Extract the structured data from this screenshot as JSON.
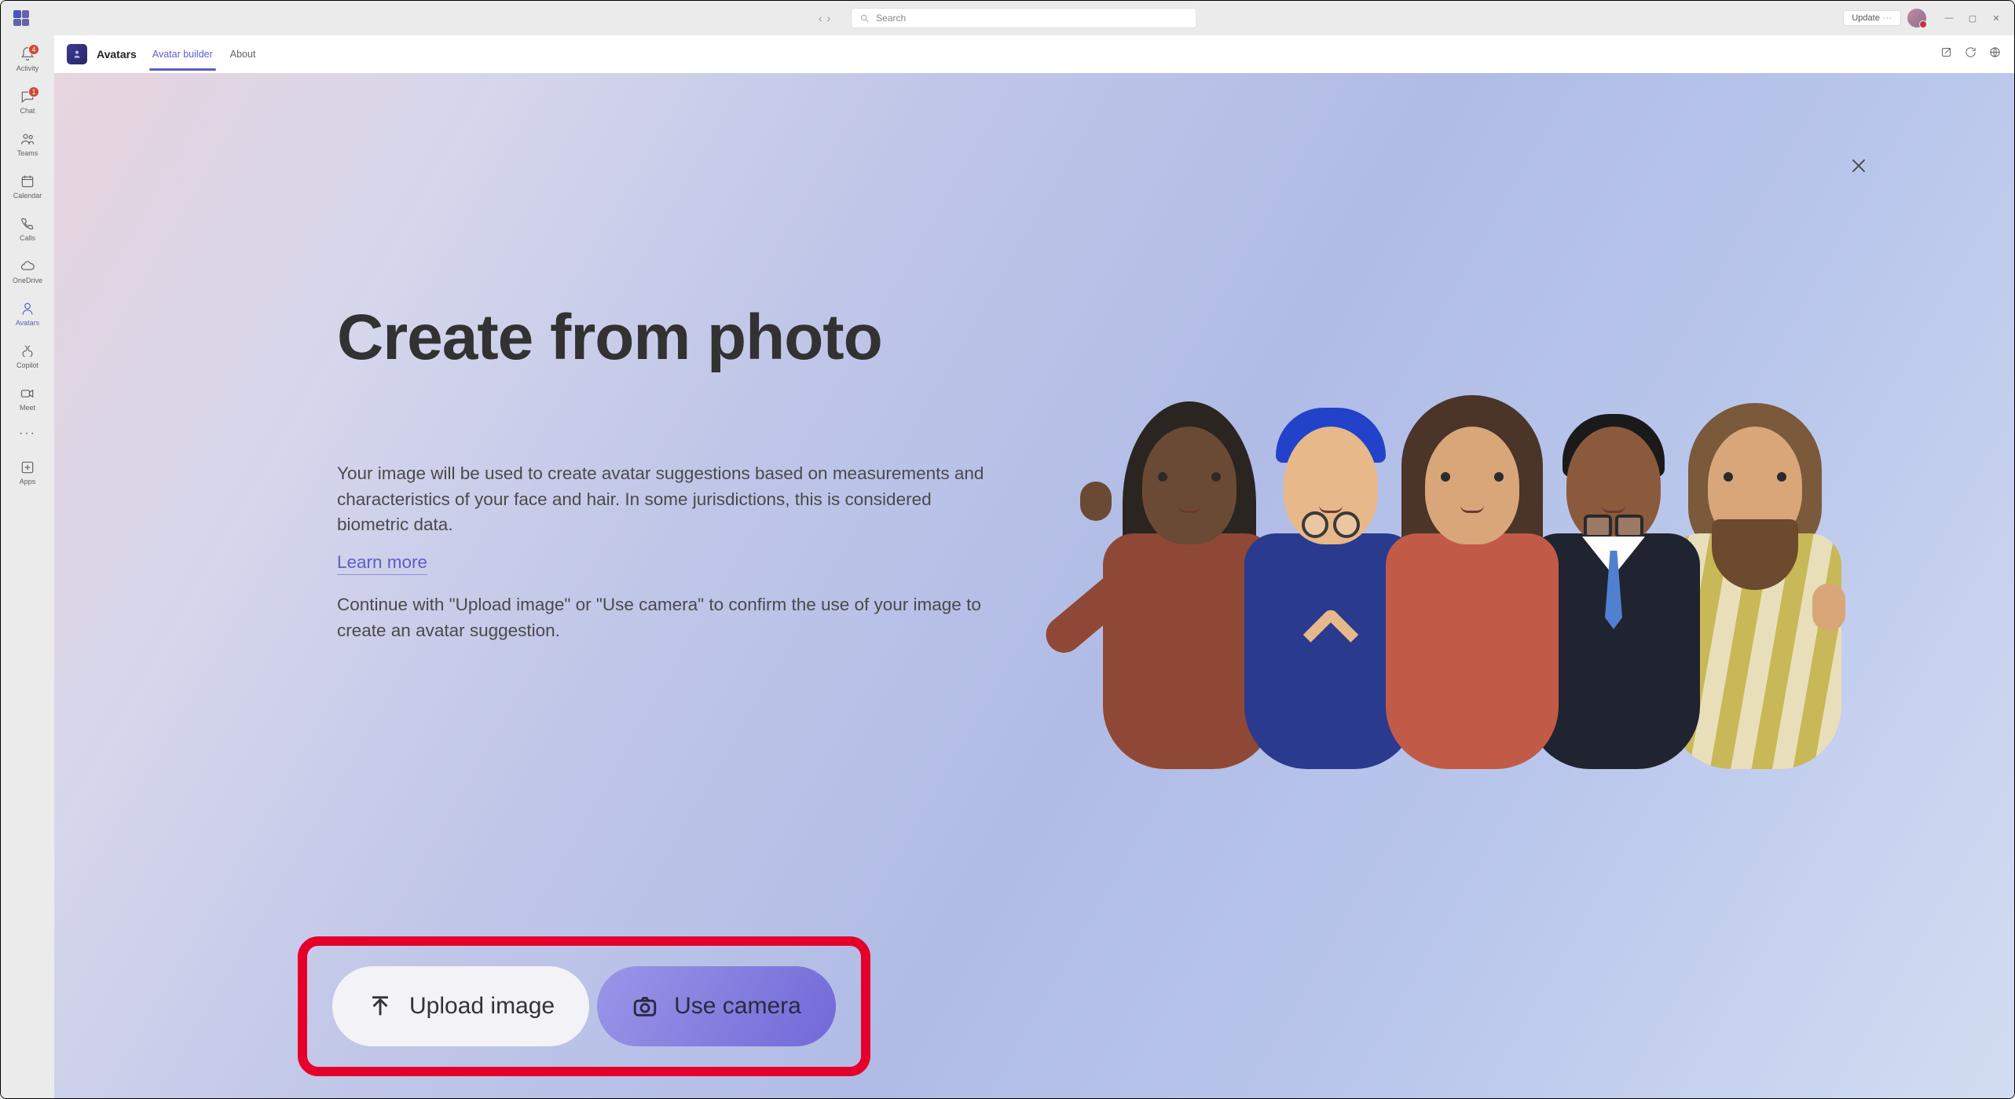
{
  "titlebar": {
    "search_placeholder": "Search",
    "update_label": "Update"
  },
  "sidebar": {
    "items": [
      {
        "label": "Activity",
        "badge": "4"
      },
      {
        "label": "Chat",
        "badge": "1"
      },
      {
        "label": "Teams"
      },
      {
        "label": "Calendar"
      },
      {
        "label": "Calls"
      },
      {
        "label": "OneDrive"
      },
      {
        "label": "Avatars"
      },
      {
        "label": "Copilot"
      },
      {
        "label": "Meet"
      }
    ],
    "apps_label": "Apps"
  },
  "appbar": {
    "title": "Avatars",
    "tabs": [
      {
        "label": "Avatar builder",
        "active": true
      },
      {
        "label": "About",
        "active": false
      }
    ]
  },
  "hero": {
    "title": "Create from photo",
    "p1": "Your image will be used to create avatar suggestions based on measurements and characteristics of your face and hair. In some jurisdictions, this is considered biometric data.",
    "link": "Learn more",
    "p2": "Continue with \"Upload image\" or \"Use camera\" to confirm the use of your image to create an avatar suggestion."
  },
  "buttons": {
    "upload": "Upload image",
    "camera": "Use camera"
  }
}
